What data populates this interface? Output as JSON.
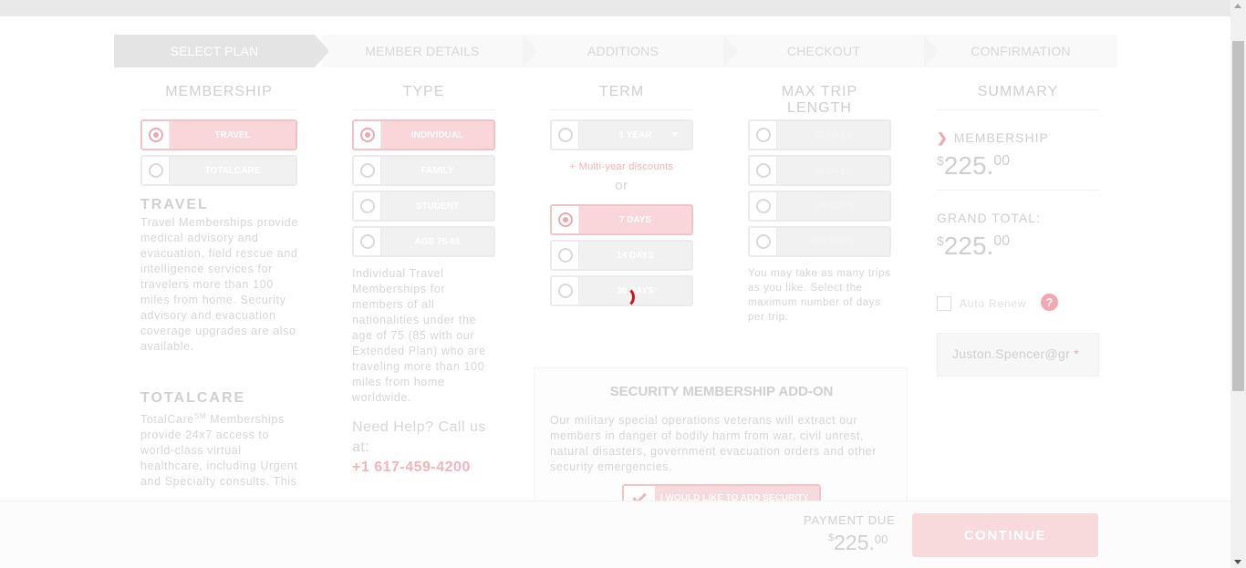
{
  "steps": [
    "SELECT PLAN",
    "MEMBER DETAILS",
    "ADDITIONS",
    "CHECKOUT",
    "CONFIRMATION"
  ],
  "columns": {
    "membership": "MEMBERSHIP",
    "type": "TYPE",
    "term": "TERM",
    "max_trip": "MAX TRIP LENGTH",
    "summary": "SUMMARY"
  },
  "membership_options": [
    "TRAVEL",
    "TOTALCARE"
  ],
  "travel": {
    "heading": "TRAVEL",
    "text": "Travel Memberships provide medical advisory and evacuation, field rescue and intelligence services for travelers more than 100 miles from home. Security advisory and evacuation coverage upgrades are also available."
  },
  "totalcare": {
    "heading": "TOTALCARE",
    "text_before": "TotalCare",
    "sm": "SM",
    "text_after": " Memberships provide 24x7 access to world-class virtual healthcare, including Urgent and Specialty consults. This"
  },
  "type_options": [
    "INDIVIDUAL",
    "FAMILY",
    "STUDENT",
    "AGE 75-85"
  ],
  "type_text": "Individual Travel Memberships for members of all nationalities under the age of 75 (85 with our Extended Plan) who are traveling more than 100 miles from home worldwide.",
  "help": {
    "text": "Need Help? Call us at:",
    "phone": "+1 617-459-4200"
  },
  "term": {
    "year_label": "1 YEAR",
    "multi_year": "+ Multi-year discounts",
    "or": "or",
    "options": [
      "7 DAYS",
      "14 DAYS",
      "30 DAYS"
    ]
  },
  "max_trip_options": [
    "45 DAYS",
    "90 DAYS",
    "180 DAYS",
    "365 DAYS"
  ],
  "max_trip_text": "You may take as many trips as you like. Select the maximum number of days per trip.",
  "summary": {
    "membership_label": "MEMBERSHIP",
    "membership_currency": "$",
    "membership_amount": "225.",
    "membership_cents": "00",
    "grand_total_label": "GRAND TOTAL:",
    "grand_currency": "$",
    "grand_amount": "225.",
    "grand_cents": "00",
    "auto_renew": "Auto Renew",
    "help_icon": "?",
    "email": "Juston.Spencer@gr",
    "required_mark": "*"
  },
  "addon": {
    "title": "SECURITY MEMBERSHIP ADD-ON",
    "text": "Our military special operations veterans will extract our members in danger of bodily harm from war, civil unrest, natural disasters, government evacuation orders and other security emergencies.",
    "button": "I WOULD LIKE TO ADD SECURITY"
  },
  "footer": {
    "payment_due": "PAYMENT DUE",
    "currency": "$",
    "amount": "225.",
    "cents": "00",
    "continue": "CONTINUE"
  },
  "colors": {
    "accent": "#d10f1f",
    "accent_faded": "#f8d9dc"
  }
}
